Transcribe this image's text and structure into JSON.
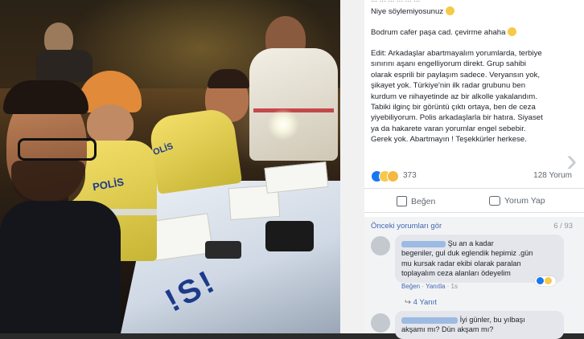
{
  "post": {
    "top_partial": "... ... ... ... ... ...",
    "line1": "Niye söylemiyosunuz",
    "line2": "Bodrum cafer paşa cad. çevirme ahaha",
    "edit_lines": [
      "Edit: Arkadaşlar abartmayalım yorumlarda, terbiye",
      "sınırını aşanı engelliyorum direkt. Grup sahibi",
      "olarak esprili bir paylaşım sadece. Veryansın yok,",
      "şikayet yok. Türkiye'nin ilk radar grubunu ben",
      "kurdum ve nihayetinde az bir alkolle yakalandım.",
      "Tabiki ilginç bir görüntü çıktı ortaya, ben de ceza",
      "yiyebiliyorum. Polis arkadaşlarla bir hatıra. Siyaset",
      "ya da hakarete varan yorumlar engel sebebir.",
      "Gerek yok. Abartmayın ! Teşekkürler herkese."
    ]
  },
  "reactions": {
    "count": "373",
    "comments_count": "128 Yorum",
    "icons": [
      "like-icon",
      "haha-icon",
      "wow-icon"
    ]
  },
  "actions": {
    "like_label": "Beğen",
    "comment_label": "Yorum Yap"
  },
  "comments": {
    "previous_label": "Önceki yorumları gör",
    "counter": "6 / 93",
    "c1": {
      "text_line1": "Şu an a kadar",
      "text_line2": "begeniler, gul duk eglendik hepimiz .gün",
      "text_line3": "mu kursak radar ekibi olarak paralan",
      "text_line4": "toplayalım ceza alanları ödeyelim",
      "like": "Beğen",
      "reply": "Yanıtla",
      "time": "1s"
    },
    "replies_label": "4 Yanıt",
    "c2": {
      "text_line1": "İyi günler, bu yılbaşı",
      "text_line2": "akşamı mı? Dün akşam mı?"
    }
  },
  "photo": {
    "vest_text_1": "POLİS",
    "vest_text_2": "OLİS"
  },
  "colors": {
    "fb_text": "#1d2129",
    "fb_muted": "#606770",
    "fb_blue": "#4267b2",
    "like_blue": "#1877f2",
    "haha_yellow": "#f7c948"
  }
}
